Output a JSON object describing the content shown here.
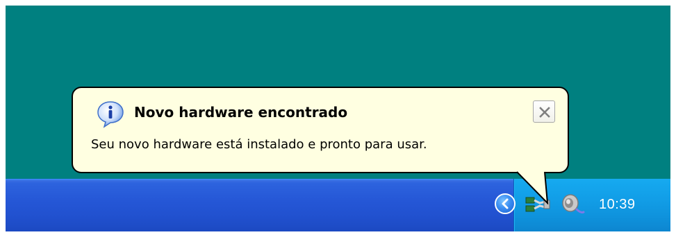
{
  "balloon": {
    "title": "Novo hardware encontrado",
    "message": "Seu novo hardware está instalado e pronto para usar.",
    "icon": "info-icon",
    "close_icon": "close-icon"
  },
  "tray": {
    "expand_icon": "chevron-left-icon",
    "network_icon": "network-connection-icon",
    "volume_icon": "speaker-volume-icon",
    "clock": "10:39"
  },
  "colors": {
    "desktop": "#008080",
    "taskbar": "#2557d6",
    "tray": "#129fe8",
    "balloon_background": "#ffffe1"
  }
}
